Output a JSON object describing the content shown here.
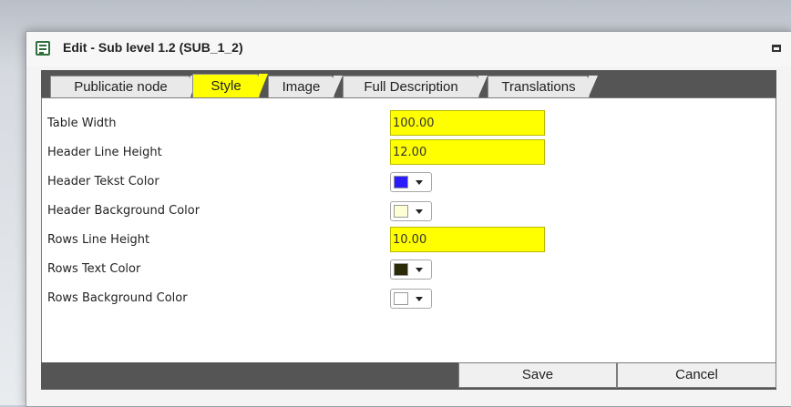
{
  "window": {
    "title": "Edit - Sub level 1.2 (SUB_1_2)"
  },
  "tabs": [
    {
      "label": "Publicatie node",
      "active": false
    },
    {
      "label": "Style",
      "active": true
    },
    {
      "label": "Image",
      "active": false
    },
    {
      "label": "Full Description",
      "active": false
    },
    {
      "label": "Translations",
      "active": false
    }
  ],
  "fields": {
    "table_width": {
      "label": "Table Width",
      "value": "100.00"
    },
    "header_line_height": {
      "label": "Header Line Height",
      "value": "12.00"
    },
    "header_text_color": {
      "label": "Header Tekst Color",
      "color": "#2b1bff"
    },
    "header_background_color": {
      "label": "Header Background Color",
      "color": "#ffffd6"
    },
    "rows_line_height": {
      "label": "Rows Line Height",
      "value": "10.00"
    },
    "rows_text_color": {
      "label": "Rows Text Color",
      "color": "#2b2a06"
    },
    "rows_background_color": {
      "label": "Rows Background Color",
      "color": "#ffffff"
    }
  },
  "buttons": {
    "save": "Save",
    "cancel": "Cancel"
  },
  "colors": {
    "active_tab": "#ffff00",
    "input_highlight": "#ffff00",
    "bar_dark": "#555555"
  },
  "icons": {
    "title": "form-icon",
    "maximize": "maximize-icon",
    "dropdown": "caret-down-icon"
  }
}
